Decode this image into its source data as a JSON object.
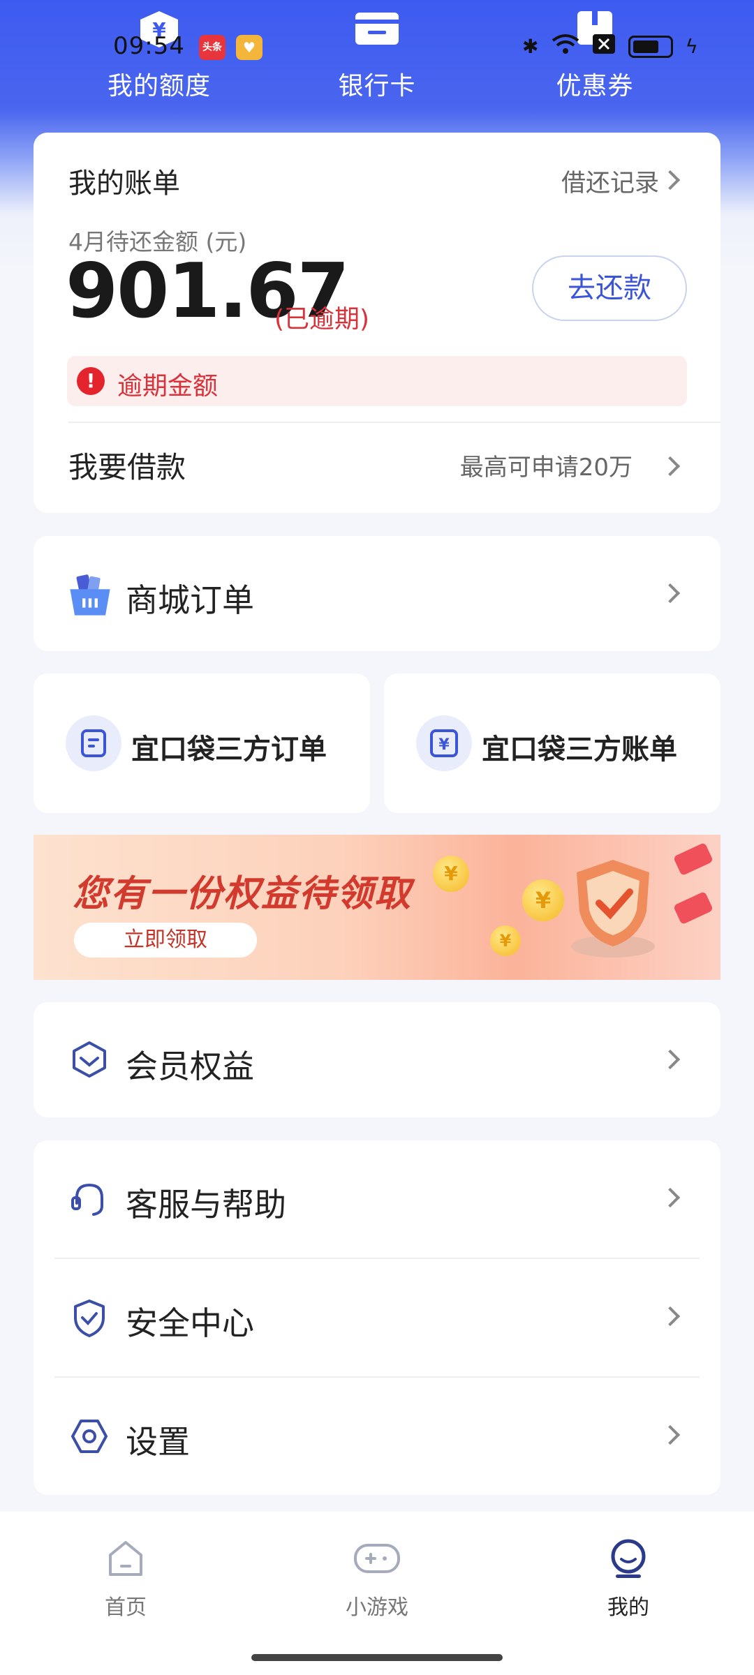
{
  "status_bar": {
    "time": "09:54",
    "badge_news": "头条",
    "badge_heart": "♥"
  },
  "top_nav": [
    {
      "label": "我的额度",
      "icon": "yen-wallet-icon"
    },
    {
      "label": "银行卡",
      "icon": "bank-card-icon"
    },
    {
      "label": "优惠券",
      "icon": "coupon-icon"
    }
  ],
  "bill": {
    "title": "我的账单",
    "record_link": "借还记录",
    "subtitle": "4月待还金额 (元)",
    "amount": "901.67",
    "overdue_tag": "(已逾期)",
    "repay_button": "去还款",
    "overdue_notice": "逾期金额",
    "borrow_label": "我要借款",
    "borrow_hint": "最高可申请20万"
  },
  "mall": {
    "label": "商城订单"
  },
  "third_party": {
    "orders": "宜口袋三方订单",
    "bills": "宜口袋三方账单"
  },
  "banner": {
    "title": "您有一份权益待领取",
    "button": "立即领取"
  },
  "member": {
    "label": "会员权益"
  },
  "services": [
    {
      "label": "客服与帮助",
      "icon": "headset-icon"
    },
    {
      "label": "安全中心",
      "icon": "shield-check-icon"
    },
    {
      "label": "设置",
      "icon": "hexagon-settings-icon"
    }
  ],
  "bottom_nav": [
    {
      "label": "首页",
      "icon": "home-icon",
      "active": false
    },
    {
      "label": "小游戏",
      "icon": "gamepad-icon",
      "active": false
    },
    {
      "label": "我的",
      "icon": "profile-smile-icon",
      "active": true
    }
  ],
  "colors": {
    "brand_blue": "#3d5bf0",
    "overdue_red": "#d8323a",
    "icon_blue": "#3b4fa8"
  }
}
